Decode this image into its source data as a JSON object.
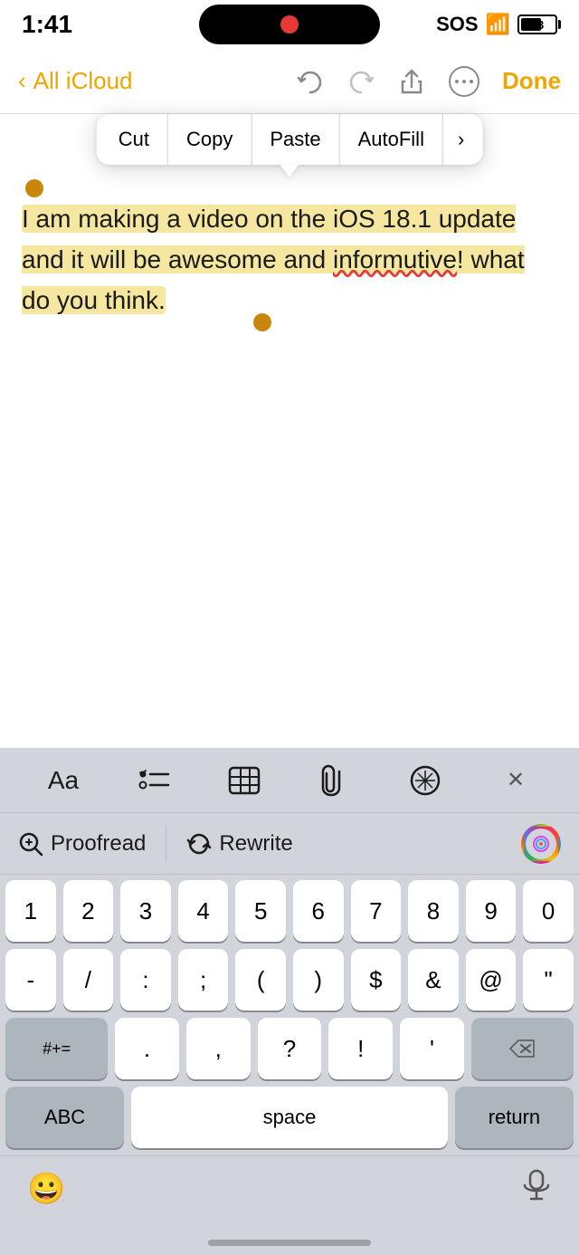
{
  "statusBar": {
    "time": "1:41",
    "sos": "SOS",
    "battery": "63"
  },
  "navBar": {
    "backLabel": "All iCloud",
    "doneLabel": "Done"
  },
  "contextMenu": {
    "items": [
      "Cut",
      "Copy",
      "Paste",
      "AutoFill"
    ],
    "moreLabel": "›"
  },
  "textContent": {
    "text": "I am making a video on the iOS 18.1 update and it will be awesome and informutive! what do you think.",
    "highlightedText": "I am making a video on the iOS 18.1 update and it will be awesome and informutive! what do you think."
  },
  "keyboard": {
    "toolbarIcons": [
      "Aa",
      "list-icon",
      "table-icon",
      "paperclip-icon",
      "compass-icon",
      "close-icon"
    ],
    "aiBar": {
      "proofreadLabel": "Proofread",
      "rewriteLabel": "Rewrite"
    },
    "numberRow": [
      "1",
      "2",
      "3",
      "4",
      "5",
      "6",
      "7",
      "8",
      "9",
      "0"
    ],
    "symbolRow": [
      "-",
      "/",
      ":",
      ";",
      "(",
      ")",
      "$",
      "&",
      "@",
      "\""
    ],
    "specialLeft": "#+= ",
    "dotRow": [
      ".",
      ",",
      "?",
      "!",
      "'"
    ],
    "abcLabel": "ABC",
    "spaceLabel": "space",
    "returnLabel": "return"
  }
}
